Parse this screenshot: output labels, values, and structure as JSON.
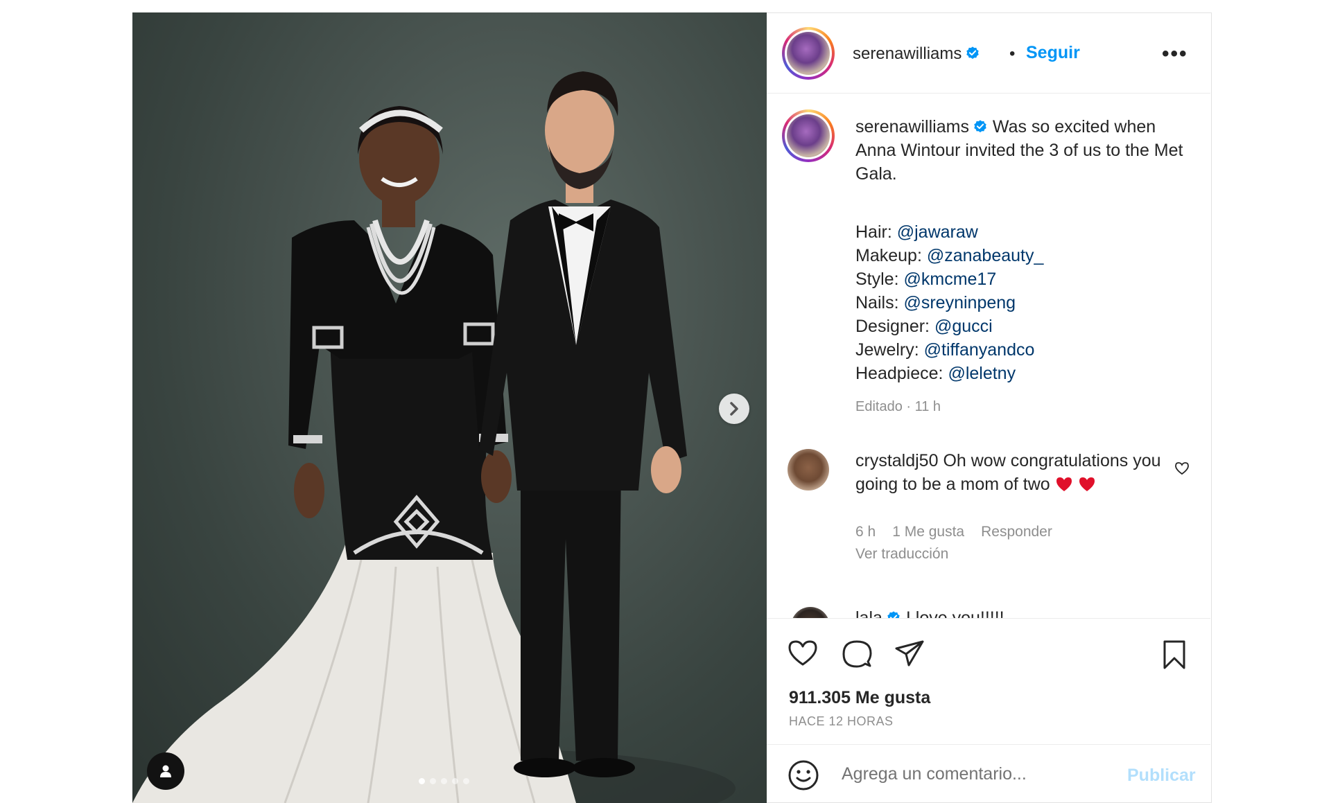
{
  "post": {
    "username": "serenawilliams",
    "follow_label": "Seguir",
    "separator": "•",
    "more_label": "•••",
    "caption": "Was so excited when Anna Wintour invited the 3 of us to the Met Gala.",
    "credits": [
      {
        "role": "Hair:",
        "handle": "@jawaraw"
      },
      {
        "role": "Makeup:",
        "handle": "@zanabeauty_"
      },
      {
        "role": "Style:",
        "handle": "@kmcme17"
      },
      {
        "role": "Nails:",
        "handle": "@sreyninpeng"
      },
      {
        "role": "Designer:",
        "handle": "@gucci"
      },
      {
        "role": "Jewelry:",
        "handle": "@tiffanyandco"
      },
      {
        "role": "Headpiece:",
        "handle": "@leletny"
      }
    ],
    "edited": "Editado · 11 h",
    "likes": "911.305 Me gusta",
    "time_ago": "HACE 12 HORAS"
  },
  "comments": [
    {
      "username": "crystaldj50",
      "text": "Oh wow congratulations you going to be a mom of two",
      "time": "6 h",
      "likes": "1 Me gusta",
      "reply": "Responder",
      "translate": "Ver traducción"
    },
    {
      "username": "lala",
      "text": "I love you!!!!!"
    }
  ],
  "comment_box": {
    "placeholder": "Agrega un comentario...",
    "publish_label": "Publicar"
  },
  "carousel": {
    "count": 5,
    "active": 0
  },
  "icons": {
    "verified": "verified-badge-icon",
    "like": "heart-icon",
    "comment": "comment-bubble-icon",
    "share": "paper-plane-icon",
    "save": "bookmark-icon",
    "emoji": "smiley-icon",
    "next": "chevron-right-icon",
    "tag": "user-tag-icon"
  },
  "colors": {
    "accent": "#0095f6",
    "link": "#00376b",
    "muted": "#8e8e8e",
    "publish_disabled": "#b2dffc",
    "heart": "#ed4956"
  }
}
